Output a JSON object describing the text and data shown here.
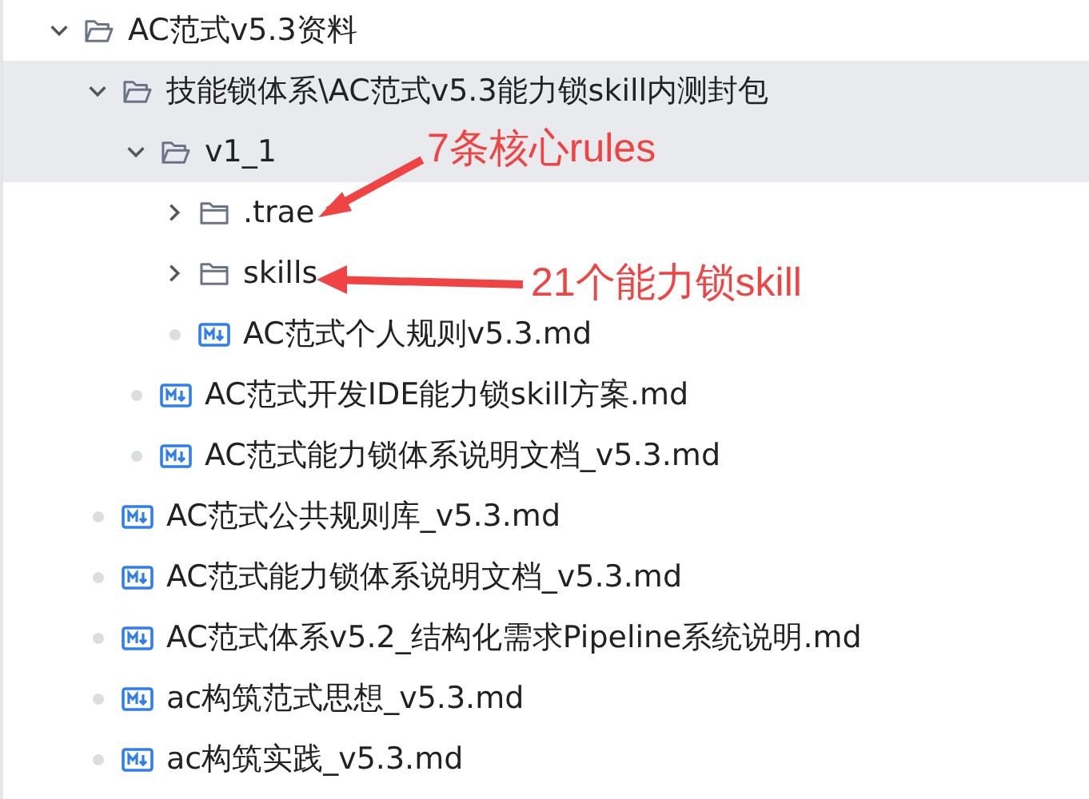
{
  "tree": [
    {
      "kind": "folder",
      "name": "AC范式v5.3资料",
      "expanded": true,
      "selected": false,
      "children": [
        {
          "kind": "folder",
          "name": "技能锁体系\\AC范式v5.3能力锁skill内测封包",
          "expanded": true,
          "selected": true,
          "children": [
            {
              "kind": "folder",
              "name": "v1_1",
              "expanded": true,
              "selected": true,
              "children": [
                {
                  "kind": "folder",
                  "name": ".trae",
                  "expanded": false,
                  "selected": false
                },
                {
                  "kind": "folder",
                  "name": "skills",
                  "expanded": false,
                  "selected": false
                },
                {
                  "kind": "file",
                  "name": "AC范式个人规则v5.3.md",
                  "selected": false
                }
              ]
            },
            {
              "kind": "file",
              "name": "AC范式开发IDE能力锁skill方案.md",
              "selected": false
            },
            {
              "kind": "file",
              "name": "AC范式能力锁体系说明文档_v5.3.md",
              "selected": false
            }
          ]
        },
        {
          "kind": "file",
          "name": "AC范式公共规则库_v5.3.md",
          "selected": false
        },
        {
          "kind": "file",
          "name": "AC范式能力锁体系说明文档_v5.3.md",
          "selected": false
        },
        {
          "kind": "file",
          "name": "AC范式体系v5.2_结构化需求Pipeline系统说明.md",
          "selected": false
        },
        {
          "kind": "file",
          "name": "ac构筑范式思想_v5.3.md",
          "selected": false
        },
        {
          "kind": "file",
          "name": "ac构筑实践_v5.3.md",
          "selected": false
        }
      ]
    }
  ],
  "annotations": [
    {
      "text": "7条核心rules",
      "color": "#f04444"
    },
    {
      "text": "21个能力锁skill",
      "color": "#f04444"
    }
  ]
}
